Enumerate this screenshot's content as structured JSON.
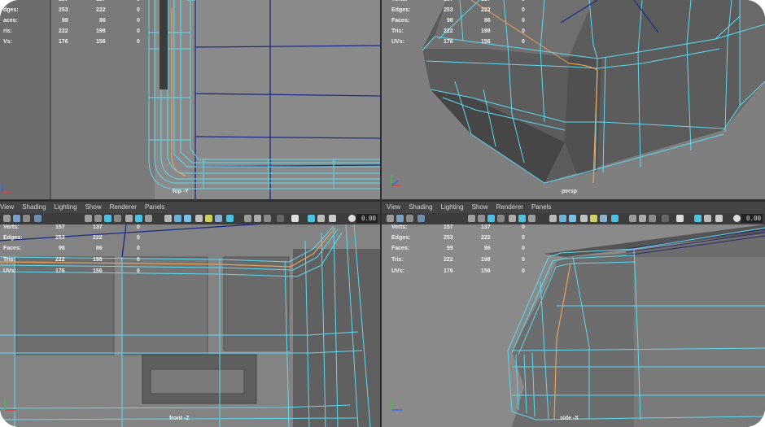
{
  "menu": [
    "View",
    "Shading",
    "Lighting",
    "Show",
    "Renderer",
    "Panels"
  ],
  "toolbar": {
    "time_value": "0.00"
  },
  "stats_labels": [
    "Verts:",
    "Edges:",
    "Faces:",
    "Tris:",
    "UVs:"
  ],
  "stats_labels_cropped": [
    "",
    "dges:",
    "aces:",
    "ris:",
    "Vs:"
  ],
  "stats_values": [
    [
      "157",
      "137",
      "0"
    ],
    [
      "253",
      "222",
      "0"
    ],
    [
      "98",
      "86",
      "0"
    ],
    [
      "222",
      "198",
      "0"
    ],
    [
      "176",
      "156",
      "0"
    ]
  ],
  "viewports": {
    "top": {
      "label": "top -Y"
    },
    "persp": {
      "label": "persp"
    },
    "front": {
      "label": "front -Z"
    },
    "side": {
      "label": "side -X"
    }
  },
  "colors": {
    "wire": "#5fd9ef",
    "seam": "#e6a15a",
    "grid": "#1a2a7a",
    "bg": "#7d7d7d"
  }
}
